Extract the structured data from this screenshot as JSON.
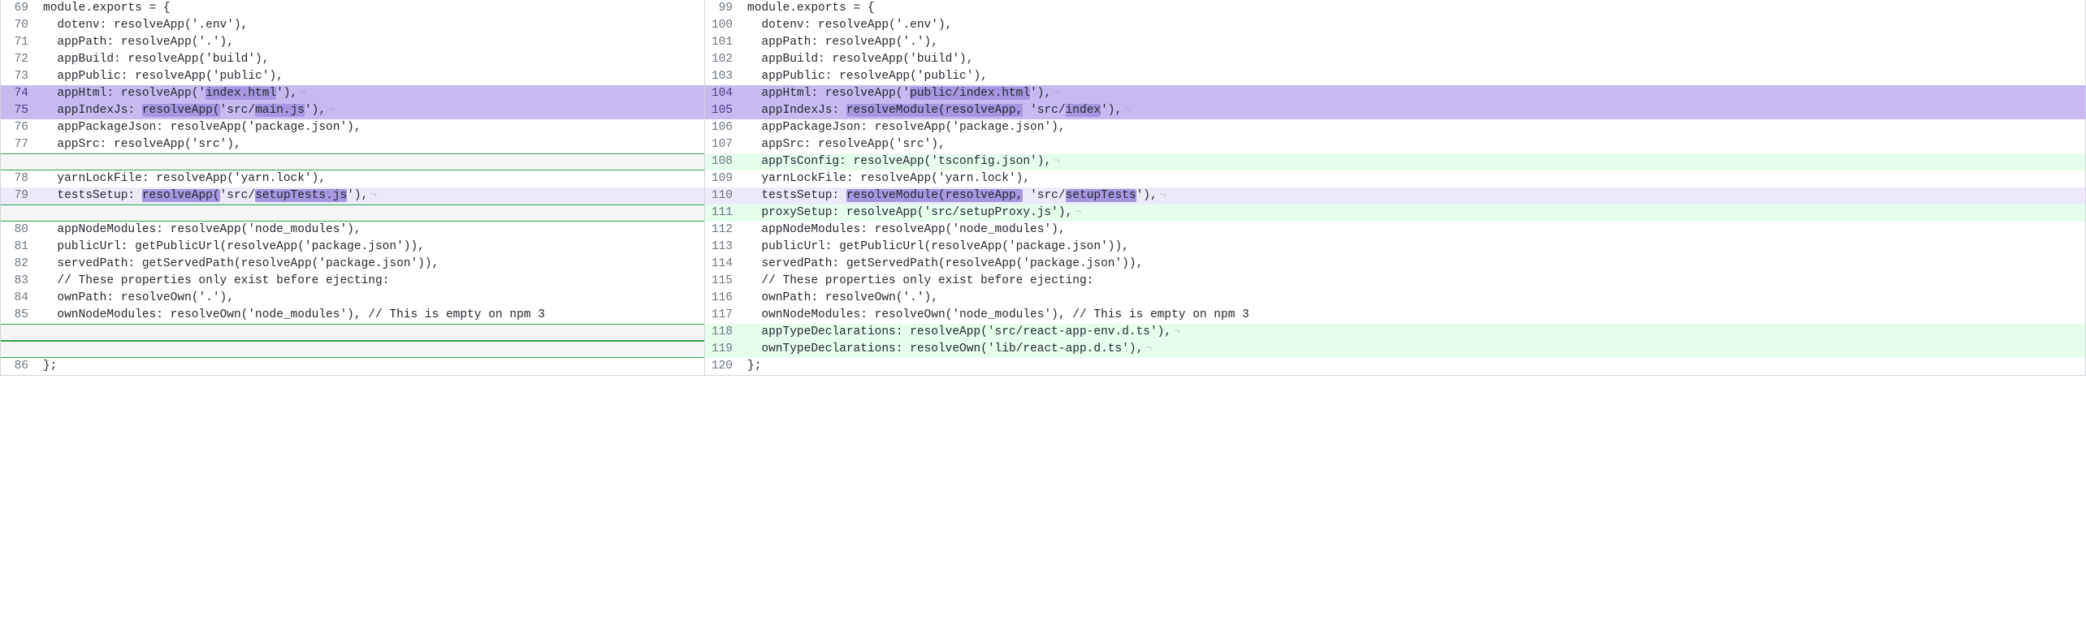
{
  "left": {
    "lines": [
      {
        "n": 69,
        "kind": "normal",
        "text": "module.exports = {"
      },
      {
        "n": 70,
        "kind": "normal",
        "text": "  dotenv: resolveApp('.env'),"
      },
      {
        "n": 71,
        "kind": "normal",
        "text": "  appPath: resolveApp('.'),"
      },
      {
        "n": 72,
        "kind": "normal",
        "text": "  appBuild: resolveApp('build'),"
      },
      {
        "n": 73,
        "kind": "normal",
        "text": "  appPublic: resolveApp('public'),"
      },
      {
        "n": 74,
        "kind": "modify-strong",
        "segs": [
          {
            "t": "  appHtml: resolveApp('"
          },
          {
            "t": "index.html",
            "hl": true
          },
          {
            "t": "'),"
          }
        ],
        "eol": true
      },
      {
        "n": 75,
        "kind": "modify-strong",
        "segs": [
          {
            "t": "  appIndexJs: "
          },
          {
            "t": "resolveApp(",
            "hl": true
          },
          {
            "t": "'src/"
          },
          {
            "t": "main.js",
            "hl": true
          },
          {
            "t": "'),"
          }
        ],
        "eol": true
      },
      {
        "n": 76,
        "kind": "normal",
        "text": "  appPackageJson: resolveApp('package.json'),"
      },
      {
        "n": 77,
        "kind": "normal",
        "text": "  appSrc: resolveApp('src'),"
      },
      {
        "n": "",
        "kind": "empty-slot",
        "text": ""
      },
      {
        "n": 78,
        "kind": "normal",
        "text": "  yarnLockFile: resolveApp('yarn.lock'),"
      },
      {
        "n": 79,
        "kind": "modify-light",
        "segs": [
          {
            "t": "  testsSetup: "
          },
          {
            "t": "resolveApp(",
            "hl": true
          },
          {
            "t": "'src/"
          },
          {
            "t": "setupTests.js",
            "hl": true
          },
          {
            "t": "'),"
          }
        ],
        "eol": true
      },
      {
        "n": "",
        "kind": "empty-slot",
        "text": ""
      },
      {
        "n": 80,
        "kind": "normal",
        "text": "  appNodeModules: resolveApp('node_modules'),"
      },
      {
        "n": 81,
        "kind": "normal",
        "text": "  publicUrl: getPublicUrl(resolveApp('package.json')),"
      },
      {
        "n": 82,
        "kind": "normal",
        "text": "  servedPath: getServedPath(resolveApp('package.json')),"
      },
      {
        "n": 83,
        "kind": "normal",
        "text": "  // These properties only exist before ejecting:"
      },
      {
        "n": 84,
        "kind": "normal",
        "text": "  ownPath: resolveOwn('.'),"
      },
      {
        "n": 85,
        "kind": "normal",
        "text": "  ownNodeModules: resolveOwn('node_modules'), // This is empty on npm 3"
      },
      {
        "n": "",
        "kind": "empty-slot",
        "text": ""
      },
      {
        "n": "",
        "kind": "empty-slot",
        "text": ""
      },
      {
        "n": 86,
        "kind": "normal",
        "text": "};"
      }
    ]
  },
  "right": {
    "lines": [
      {
        "n": 99,
        "kind": "normal",
        "text": "module.exports = {"
      },
      {
        "n": 100,
        "kind": "normal",
        "text": "  dotenv: resolveApp('.env'),"
      },
      {
        "n": 101,
        "kind": "normal",
        "text": "  appPath: resolveApp('.'),"
      },
      {
        "n": 102,
        "kind": "normal",
        "text": "  appBuild: resolveApp('build'),"
      },
      {
        "n": 103,
        "kind": "normal",
        "text": "  appPublic: resolveApp('public'),"
      },
      {
        "n": 104,
        "kind": "modify-strong",
        "segs": [
          {
            "t": "  appHtml: resolveApp('"
          },
          {
            "t": "public/index.html",
            "hl": true
          },
          {
            "t": "'),"
          }
        ],
        "eol": true
      },
      {
        "n": 105,
        "kind": "modify-strong",
        "segs": [
          {
            "t": "  appIndexJs: "
          },
          {
            "t": "resolveModule(resolveApp,",
            "hl": true
          },
          {
            "t": " 'src/"
          },
          {
            "t": "index",
            "hl": true
          },
          {
            "t": "'),"
          }
        ],
        "eol": true
      },
      {
        "n": 106,
        "kind": "normal",
        "text": "  appPackageJson: resolveApp('package.json'),"
      },
      {
        "n": 107,
        "kind": "normal",
        "text": "  appSrc: resolveApp('src'),"
      },
      {
        "n": 108,
        "kind": "add",
        "text": "  appTsConfig: resolveApp('tsconfig.json'),",
        "eol": true
      },
      {
        "n": 109,
        "kind": "normal",
        "text": "  yarnLockFile: resolveApp('yarn.lock'),"
      },
      {
        "n": 110,
        "kind": "modify-light",
        "segs": [
          {
            "t": "  testsSetup: "
          },
          {
            "t": "resolveModule(resolveApp,",
            "hl": true
          },
          {
            "t": " 'src/"
          },
          {
            "t": "setupTests",
            "hl": true
          },
          {
            "t": "'),"
          }
        ],
        "eol": true
      },
      {
        "n": 111,
        "kind": "add",
        "text": "  proxySetup: resolveApp('src/setupProxy.js'),",
        "eol": true
      },
      {
        "n": 112,
        "kind": "normal",
        "text": "  appNodeModules: resolveApp('node_modules'),"
      },
      {
        "n": 113,
        "kind": "normal",
        "text": "  publicUrl: getPublicUrl(resolveApp('package.json')),"
      },
      {
        "n": 114,
        "kind": "normal",
        "text": "  servedPath: getServedPath(resolveApp('package.json')),"
      },
      {
        "n": 115,
        "kind": "normal",
        "text": "  // These properties only exist before ejecting:"
      },
      {
        "n": 116,
        "kind": "normal",
        "text": "  ownPath: resolveOwn('.'),"
      },
      {
        "n": 117,
        "kind": "normal",
        "text": "  ownNodeModules: resolveOwn('node_modules'), // This is empty on npm 3"
      },
      {
        "n": 118,
        "kind": "add",
        "text": "  appTypeDeclarations: resolveApp('src/react-app-env.d.ts'),",
        "eol": true
      },
      {
        "n": 119,
        "kind": "add",
        "text": "  ownTypeDeclarations: resolveOwn('lib/react-app.d.ts'),",
        "eol": true
      },
      {
        "n": 120,
        "kind": "normal",
        "text": "};"
      }
    ]
  }
}
